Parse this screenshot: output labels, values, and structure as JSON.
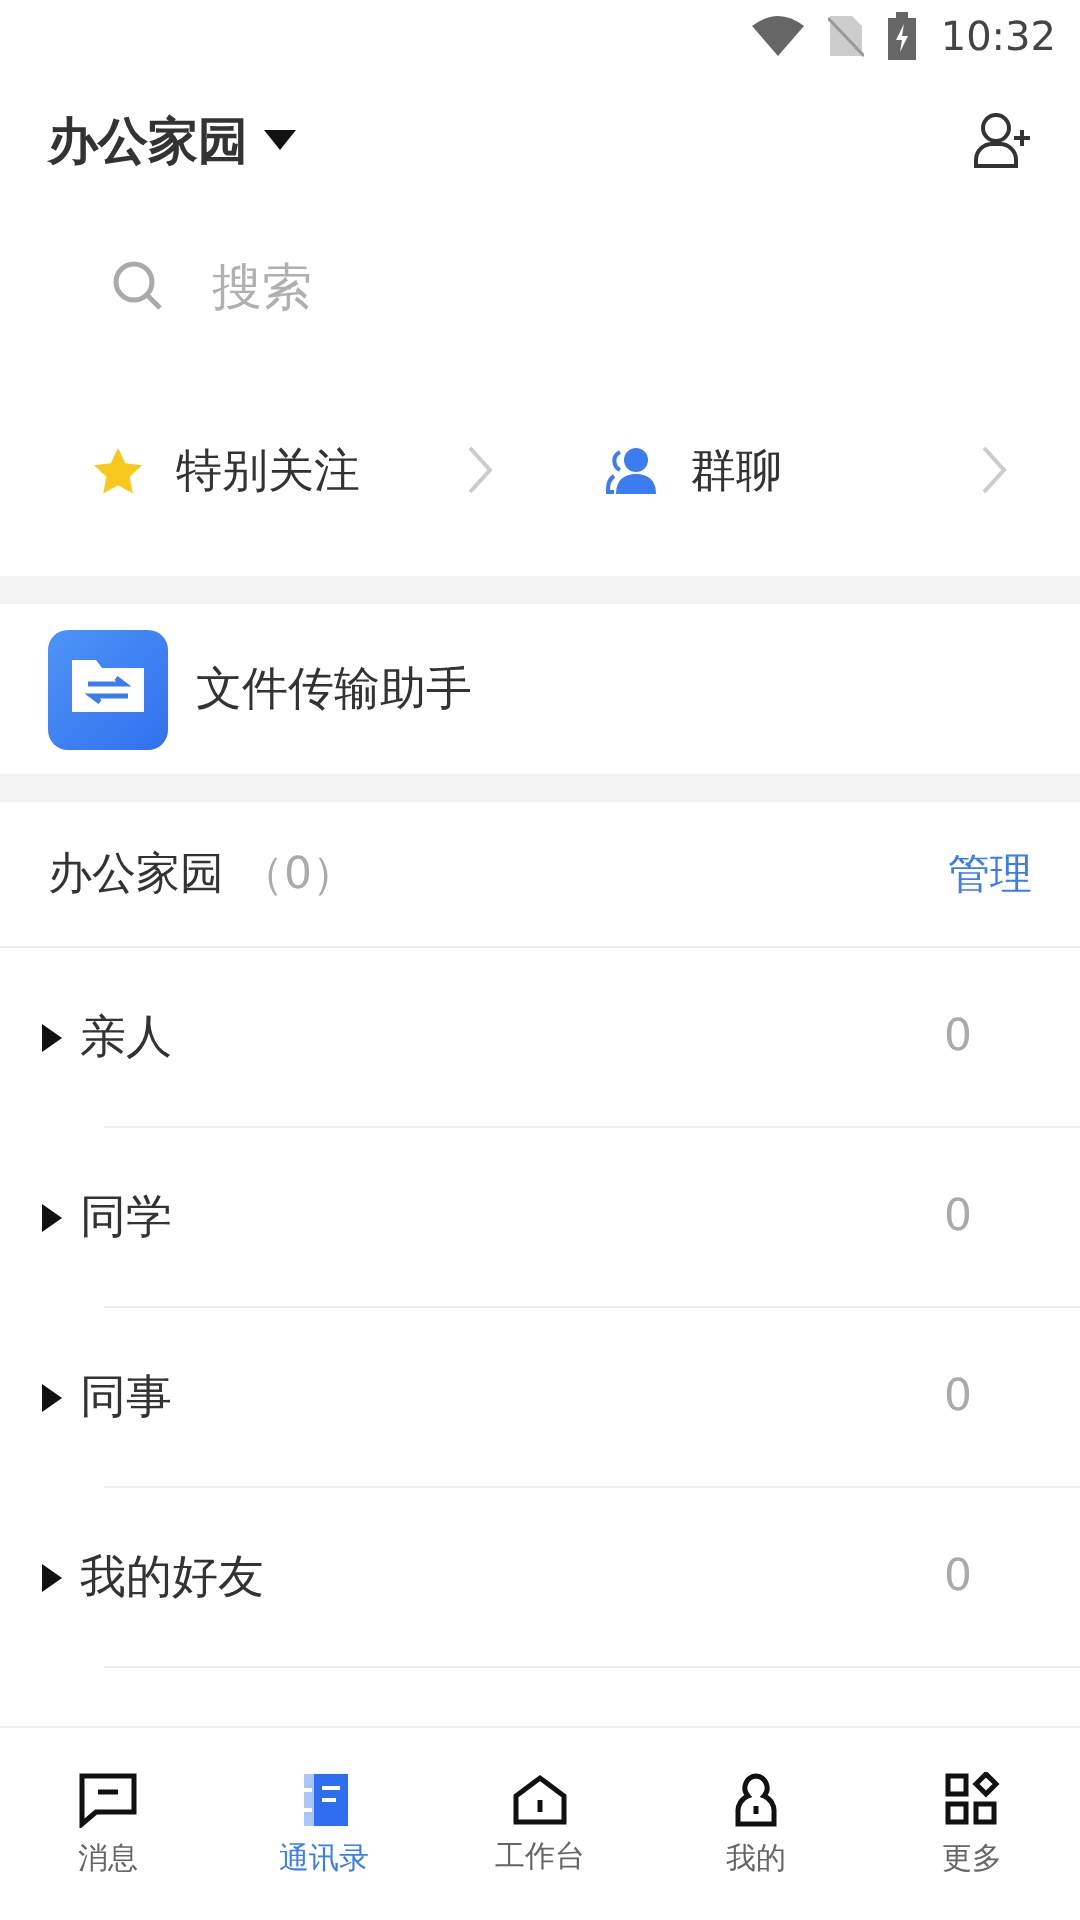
{
  "status_bar": {
    "time": "10:32"
  },
  "header": {
    "title": "办公家园"
  },
  "search": {
    "placeholder": "搜索"
  },
  "shortcuts": [
    {
      "kind": "star",
      "label": "特别关注"
    },
    {
      "kind": "group",
      "label": "群聊"
    }
  ],
  "file_helper": {
    "label": "文件传输助手"
  },
  "org": {
    "name": "办公家园",
    "count": "（0）",
    "action": "管理"
  },
  "groups": [
    {
      "name": "亲人",
      "count": "0",
      "expanded": false
    },
    {
      "name": "同学",
      "count": "0",
      "expanded": false
    },
    {
      "name": "同事",
      "count": "0",
      "expanded": false
    },
    {
      "name": "我的好友",
      "count": "0",
      "expanded": false
    }
  ],
  "tabs": [
    {
      "kind": "chat",
      "label": "消息",
      "selected": false
    },
    {
      "kind": "contacts",
      "label": "通讯录",
      "selected": true
    },
    {
      "kind": "home",
      "label": "工作台",
      "selected": false
    },
    {
      "kind": "me",
      "label": "我的",
      "selected": false
    },
    {
      "kind": "more",
      "label": "更多",
      "selected": false
    }
  ]
}
